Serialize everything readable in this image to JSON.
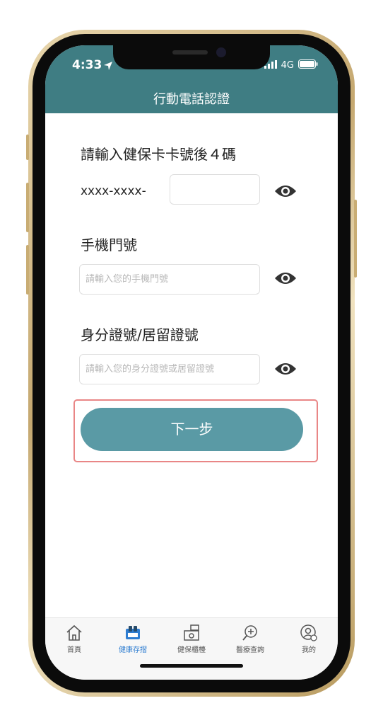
{
  "status_bar": {
    "time": "4:33",
    "network": "4G"
  },
  "header": {
    "title": "行動電話認證"
  },
  "form": {
    "card": {
      "label": "請輸入健保卡卡號後４碼",
      "prefix": "xxxx-xxxx-",
      "value": ""
    },
    "phone": {
      "label": "手機門號",
      "placeholder": "請輸入您的手機門號"
    },
    "id": {
      "label": "身分證號/居留證號",
      "placeholder": "請輸入您的身分證號或居留證號"
    }
  },
  "next_button": {
    "label": "下一步"
  },
  "tabbar": {
    "items": [
      {
        "label": "首頁",
        "icon": "home-icon"
      },
      {
        "label": "健康存摺",
        "icon": "health-passbook-icon",
        "active": true
      },
      {
        "label": "健保櫃檯",
        "icon": "counter-icon"
      },
      {
        "label": "醫療查詢",
        "icon": "medical-search-icon"
      },
      {
        "label": "我的",
        "icon": "profile-icon"
      }
    ],
    "active_color": "#2e7dd1"
  },
  "colors": {
    "header": "#3f7d83",
    "button": "#5a9aa5",
    "highlight_outline": "#e98686"
  }
}
